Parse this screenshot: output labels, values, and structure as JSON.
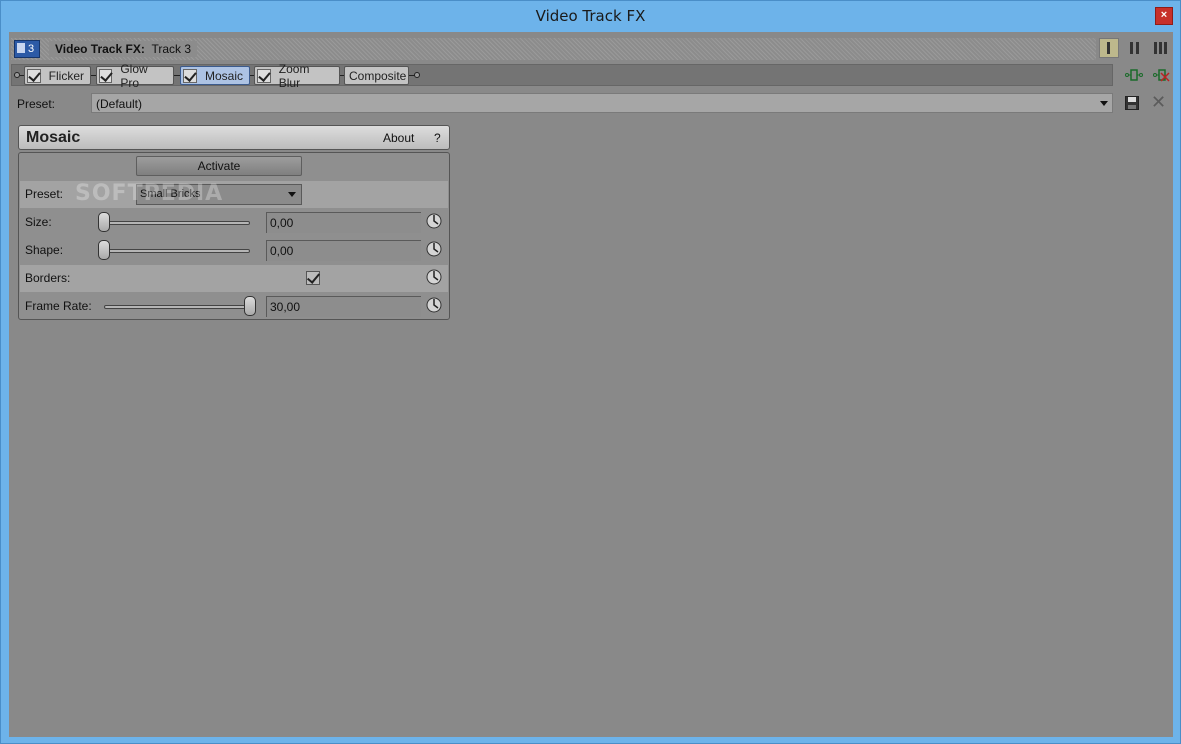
{
  "window": {
    "title": "Video Track FX",
    "close_glyph": "×"
  },
  "header": {
    "track_number": "3",
    "label_bold": "Video Track FX:",
    "label_value": "Track 3"
  },
  "fx_chain": {
    "items": [
      {
        "label": "Flicker",
        "checked": true,
        "selected": false
      },
      {
        "label": "Glow Pro",
        "checked": true,
        "selected": false
      },
      {
        "label": "Mosaic",
        "checked": true,
        "selected": true
      },
      {
        "label": "Zoom Blur",
        "checked": true,
        "selected": false
      },
      {
        "label": "Composite",
        "checked": false,
        "selected": false
      }
    ]
  },
  "preset_bar": {
    "label": "Preset:",
    "value": "(Default)"
  },
  "plugin": {
    "title": "Mosaic",
    "about": "About",
    "help": "?",
    "activate": "Activate",
    "preset_label": "Preset:",
    "preset_value": "Small Bricks",
    "watermark": "SOFTPEDIA",
    "size": {
      "label": "Size:",
      "value": "0,00",
      "slider_fraction": 0.0
    },
    "shape": {
      "label": "Shape:",
      "value": "0,00",
      "slider_fraction": 0.0
    },
    "borders": {
      "label": "Borders:",
      "checked": true
    },
    "frame_rate": {
      "label": "Frame Rate:",
      "value": "30,00",
      "slider_fraction": 1.0
    }
  },
  "colors": {
    "window_frame": "#6db3ea",
    "client_bg": "#898989",
    "close_red": "#c7302a",
    "selected_tab": "#adc3e4",
    "track_badge": "#2c5aa6"
  }
}
